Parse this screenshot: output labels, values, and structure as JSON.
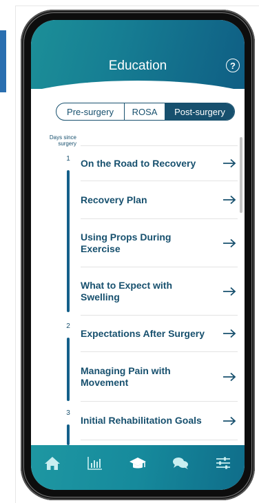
{
  "header": {
    "title": "Education",
    "help_icon": "question-circle-icon"
  },
  "segments": {
    "pre": "Pre-surgery",
    "rosa": "ROSA",
    "post": "Post-surgery",
    "selected": "Post-surgery"
  },
  "timeline": {
    "label_line1": "Days since",
    "label_line2": "surgery"
  },
  "days": [
    "1",
    "2",
    "3"
  ],
  "lessons": [
    {
      "title": "On the Road to Recovery"
    },
    {
      "title": "Recovery Plan"
    },
    {
      "title": "Using Props During Exercise"
    },
    {
      "title": "What to Expect with Swelling"
    },
    {
      "title": "Expectations After Surgery"
    },
    {
      "title": "Managing Pain with Movement"
    },
    {
      "title": "Initial Rehabilitation Goals"
    }
  ],
  "tabs": [
    {
      "icon": "home-icon"
    },
    {
      "icon": "chart-icon"
    },
    {
      "icon": "graduation-cap-icon",
      "active": true
    },
    {
      "icon": "chat-icon"
    },
    {
      "icon": "sliders-icon"
    }
  ],
  "colors": {
    "accent": "#17506e",
    "header_teal": "#1c8f98",
    "header_blue": "#0f5e84"
  }
}
